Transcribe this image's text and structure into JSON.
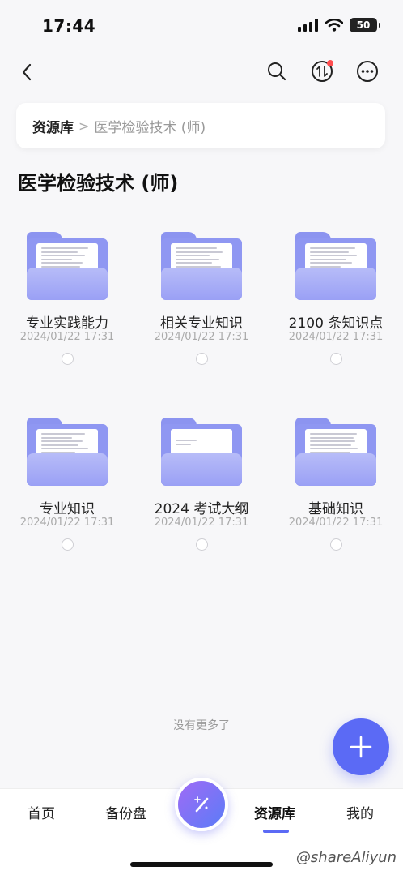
{
  "status": {
    "time": "17:44",
    "battery": "50"
  },
  "breadcrumb": {
    "root": "资源库",
    "separator": ">",
    "current": "医学检验技术 (师)"
  },
  "page_title": "医学检验技术 (师)",
  "items": [
    {
      "name": "专业实践能力",
      "date": "2024/01/22 17:31"
    },
    {
      "name": "相关专业知识",
      "date": "2024/01/22 17:31"
    },
    {
      "name": "2100 条知识点",
      "date": "2024/01/22 17:31"
    },
    {
      "name": "专业知识",
      "date": "2024/01/22 17:31"
    },
    {
      "name": "2024 考试大纲",
      "date": "2024/01/22 17:31"
    },
    {
      "name": "基础知识",
      "date": "2024/01/22 17:31"
    }
  ],
  "no_more": "没有更多了",
  "tabs": {
    "home": "首页",
    "backup": "备份盘",
    "library": "资源库",
    "mine": "我的"
  },
  "watermark": "@shareAliyun",
  "colors": {
    "accent": "#5b6af5",
    "folder": "#8f97f2",
    "badge": "#ff4d4f"
  },
  "icons": [
    "back-arrow-icon",
    "search-icon",
    "transfer-icon",
    "more-icon",
    "folder-icon",
    "plus-icon",
    "magic-wand-icon"
  ]
}
